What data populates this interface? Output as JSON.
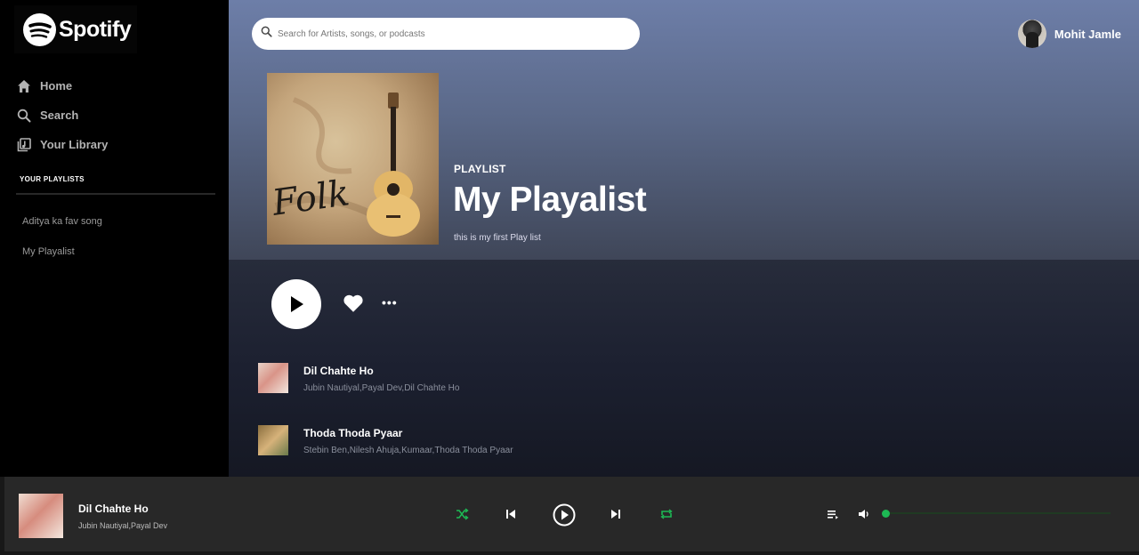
{
  "brand": {
    "name": "Spotify",
    "accent": "#1db954"
  },
  "sidebar": {
    "nav": [
      {
        "label": "Home",
        "icon": "home-icon"
      },
      {
        "label": "Search",
        "icon": "search-icon"
      },
      {
        "label": "Your Library",
        "icon": "library-icon"
      }
    ],
    "playlists_heading": "YOUR PLAYLISTS",
    "playlists": [
      "Aditya ka fav song",
      "My Playalist"
    ]
  },
  "header": {
    "search_placeholder": "Search for Artists, songs, or podcasts",
    "user_name": "Mohit Jamle"
  },
  "playlist": {
    "type": "PLAYLIST",
    "title": "My Playalist",
    "description": "this is my first Play list",
    "cover_text": "Folk"
  },
  "actions": {
    "more_label": "•••"
  },
  "tracks": [
    {
      "title": "Dil Chahte Ho",
      "artists": "Jubin Nautiyal,Payal Dev,Dil Chahte Ho"
    },
    {
      "title": "Thoda Thoda Pyaar",
      "artists": "Stebin Ben,Nilesh Ahuja,Kumaar,Thoda Thoda Pyaar"
    }
  ],
  "now_playing": {
    "title": "Dil Chahte Ho",
    "artist": "Jubin Nautiyal,Payal Dev",
    "volume": 0
  }
}
